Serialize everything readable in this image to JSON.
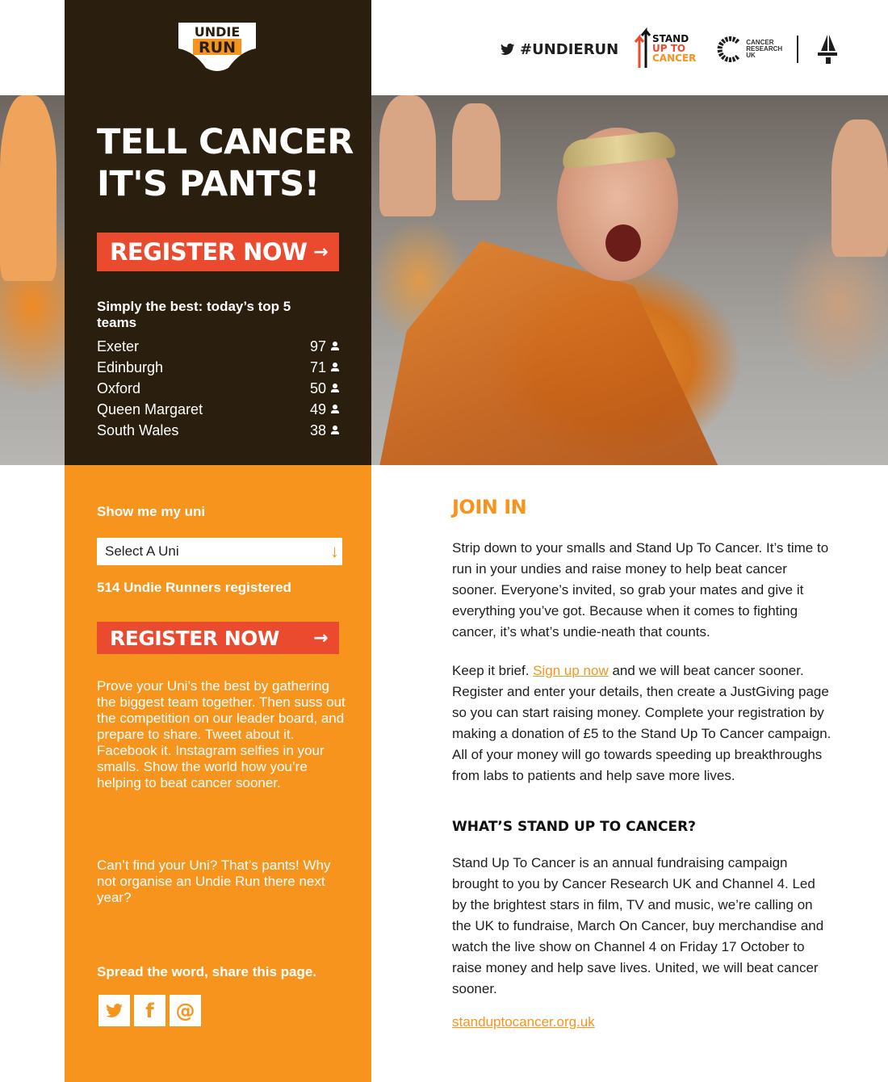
{
  "header": {
    "logo_top": "UNDIE",
    "logo_bottom": "RUN",
    "hashtag": "#UNDIERUN",
    "sutc_lines": [
      "STAND",
      "UP TO",
      "CANCER"
    ],
    "cruk_lines": [
      "CANCER",
      "RESEARCH",
      "UK"
    ]
  },
  "hero": {
    "headline_line1": "TELL CANCER",
    "headline_line2": "IT'S PANTS!",
    "register_label": "REGISTER NOW",
    "register_arrow": "→"
  },
  "top5": {
    "title": "Simply the best: today’s top 5 teams",
    "teams": [
      {
        "name": "Exeter",
        "count": "97"
      },
      {
        "name": "Edinburgh",
        "count": "71"
      },
      {
        "name": "Oxford",
        "count": "50"
      },
      {
        "name": "Queen Margaret",
        "count": "49"
      },
      {
        "name": "South Wales",
        "count": "38"
      }
    ]
  },
  "sidebar": {
    "show_uni_label": "Show me my uni",
    "select_value": "Select A Uni",
    "select_arrow": "↓",
    "registered": "514 Undie Runners registered",
    "register_label": "REGISTER NOW",
    "register_arrow": "→",
    "prove_text": "Prove your Uni’s the best by gathering the biggest team together. Then suss out the competition on our leader board, and prepare to share. Tweet about it. Facebook it. Instagram selfies in your smalls. Show the world how you’re helping to beat cancer sooner.",
    "cant_find": "Can’t find your Uni? That’s pants! Why not organise an Undie Run there next year?",
    "spread": "Spread the word, share this page.",
    "share": {
      "twitter": "twitter-icon",
      "facebook": "f",
      "email": "@"
    }
  },
  "main": {
    "join_in": "JOIN IN",
    "para1": "Strip down to your smalls and Stand Up To Cancer. It’s time to run in your undies and raise money to help beat cancer sooner. Everyone’s invited, so grab your mates and give it everything you’ve got. Because when it comes to fighting cancer, it’s what’s undie-neath that counts.",
    "para2_before": "Keep it brief. ",
    "para2_link": "Sign up now",
    "para2_after": " and we will beat cancer sooner. Register and enter your details, then create a JustGiving page so you can start raising money. Complete your registration by making a donation of £5 to the Stand Up To Cancer campaign. All of your money will go towards speeding up breakthroughs from labs to patients and help save more lives.",
    "subhead": "WHAT’S STAND UP TO CANCER?",
    "para3": "Stand Up To Cancer is an annual fundraising campaign brought to you by Cancer Research UK and Channel 4. Led by the brightest stars in film, TV and music, we’re calling on the UK to fundraise, March On Cancer, buy merchandise and watch the live show on Channel 4 on Friday 17 October to raise money and help save lives. United, we will beat cancer sooner.",
    "site_link": "standuptocancer.org.uk"
  },
  "colors": {
    "orange": "#f7941d",
    "dark": "#2a1f0e",
    "red": "#ea4b2f"
  }
}
